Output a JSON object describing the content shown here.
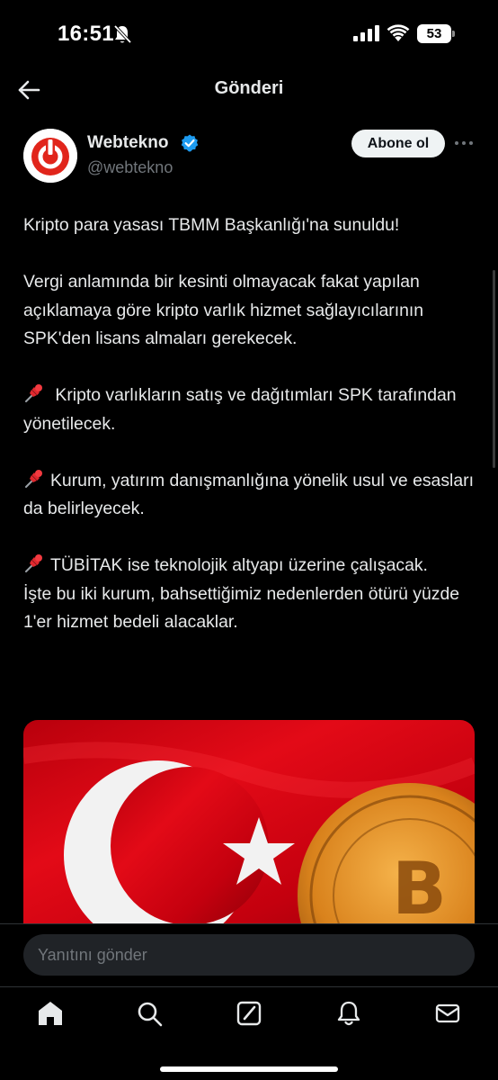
{
  "status_bar": {
    "time": "16:51",
    "battery": "53",
    "icons": [
      "bell-off-icon",
      "signal-icon",
      "wifi-icon",
      "battery-icon"
    ]
  },
  "header": {
    "title": "Gönderi",
    "back_icon": "arrow-left-icon"
  },
  "post": {
    "author": {
      "name": "Webtekno",
      "handle": "@webtekno",
      "verified": true,
      "avatar_color": "#e1251b"
    },
    "follow_label": "Abone ol",
    "paragraphs": [
      "Kripto para yasası TBMM Başkanlığı'na sunuldu!",
      "Vergi anlamında bir kesinti olmayacak fakat yapılan açıklamaya göre kripto varlık hizmet sağlayıcılarının SPK'den lisans almaları gerekecek.",
      " Kripto varlıkların satış ve dağıtımları SPK tarafından yönetilecek.",
      "Kurum, yatırım danışmanlığına yönelik usul ve esasları da belirleyecek.",
      "TÜBİTAK ise teknolojik altyapı üzerine çalışacak.",
      "İşte bu iki kurum, bahsettiğimiz nedenlerden ötürü yüzde 1'er hizmet bedeli alacaklar."
    ],
    "image": {
      "description_icon": "turkish-flag-bitcoin-image",
      "flag_color": "#e30a17"
    }
  },
  "reply": {
    "placeholder": "Yanıtını gönder"
  },
  "nav": {
    "items": [
      "home-icon",
      "search-icon",
      "grok-icon",
      "notifications-icon",
      "messages-icon"
    ]
  },
  "colors": {
    "background": "#000000",
    "text": "#e7e9ea",
    "secondary": "#71767b",
    "verified": "#1d9bf0"
  }
}
